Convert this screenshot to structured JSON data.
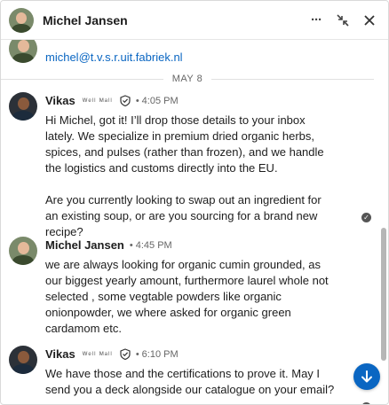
{
  "header": {
    "contact_name": "Michel Jansen",
    "more_label": "···"
  },
  "previous_message": {
    "email": "michel@t.v.s.r.uit.fabriek.nl"
  },
  "date_separator": "MAY 8",
  "messages": [
    {
      "sender": "Vikas",
      "subtitle": "ᵂᵉˡˡ ᴹᵃˡˡ",
      "dot": "•",
      "time": "4:05 PM",
      "text": "Hi Michel, got it! I’ll drop those details to your inbox lately. We specialize in premium dried organic herbs, spices, and pulses (rather than frozen), and we handle the logistics and customs directly into the EU.\n\nAre you currently looking to swap out an ingredient for an existing soup, or are you sourcing for a brand new recipe?"
    },
    {
      "sender": "Michel Jansen",
      "dot": "•",
      "time": "4:45 PM",
      "text": "we are always looking for organic cumin grounded, as our biggest yearly amount, furthermore laurel whole not selected , some vegtable powders like organic onionpowder, we where asked for organic green cardamom  etc."
    },
    {
      "sender": "Vikas",
      "subtitle": "ᵂᵉˡˡ ᴹᵃˡˡ",
      "dot": "•",
      "time": "6:10 PM",
      "text": "We have those and the certifications to prove it. May I send you a deck alongside our catalogue on your email?"
    }
  ],
  "colors": {
    "link": "#0a66c2",
    "fab": "#0a66c2"
  },
  "icons": [
    "more-icon",
    "minimize-icon",
    "close-icon",
    "verified-shield-icon",
    "read-receipt-icon",
    "scroll-down-arrow-icon"
  ]
}
